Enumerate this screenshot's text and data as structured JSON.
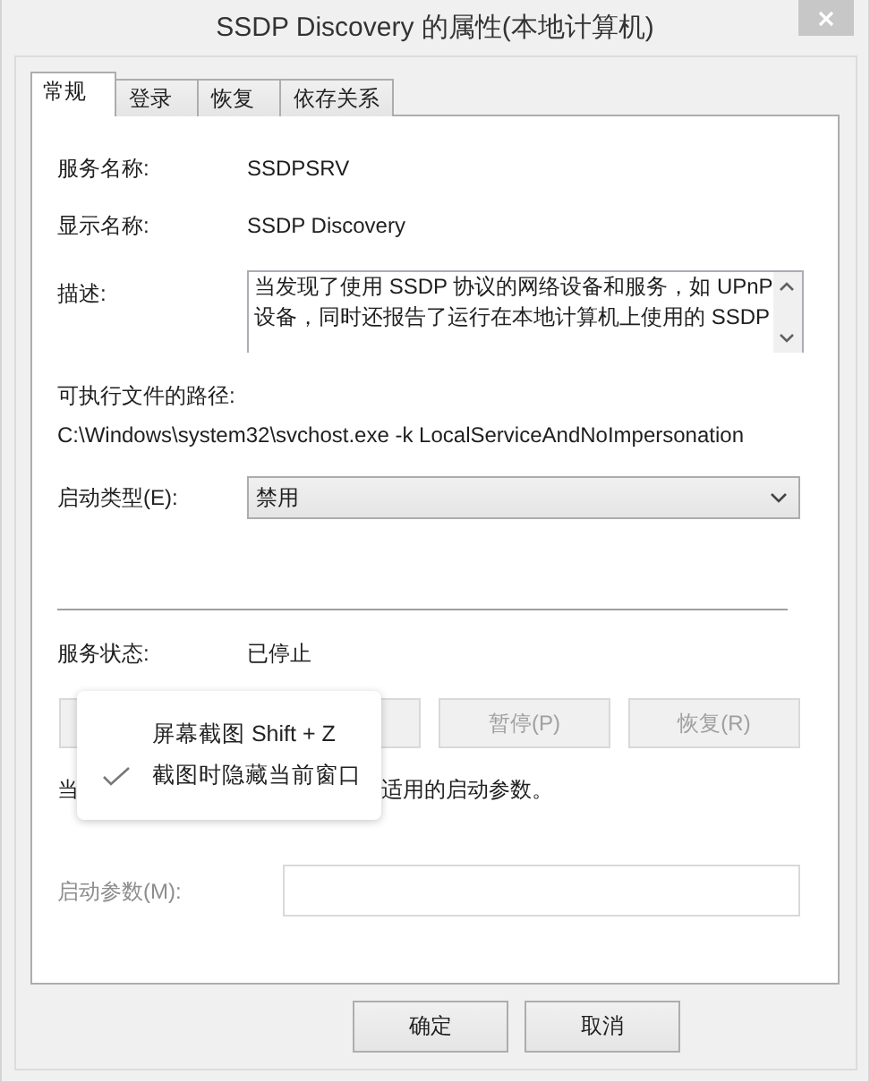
{
  "window": {
    "title": "SSDP Discovery 的属性(本地计算机)"
  },
  "tabs": [
    {
      "label": "常规",
      "selected": true
    },
    {
      "label": "登录",
      "selected": false
    },
    {
      "label": "恢复",
      "selected": false
    },
    {
      "label": "依存关系",
      "selected": false
    }
  ],
  "service_name": {
    "label": "服务名称:",
    "value": "SSDPSRV"
  },
  "display_name": {
    "label": "显示名称:",
    "value": "SSDP Discovery"
  },
  "description": {
    "label": "描述:",
    "lines": [
      "当发现了使用 SSDP 协议的网络设备和服务，如 UPnP",
      "设备，同时还报告了运行在本地计算机上使用的 SSDP"
    ]
  },
  "path": {
    "label": "可执行文件的路径:",
    "value": "C:\\Windows\\system32\\svchost.exe -k LocalServiceAndNoImpersonation"
  },
  "startup_type": {
    "label": "启动类型(E):",
    "value": "禁用"
  },
  "service_status": {
    "label": "服务状态:",
    "value": "已停止"
  },
  "service_buttons": [
    {
      "disabled": true
    },
    {
      "disabled": true
    },
    {
      "label": "暂停(P)",
      "disabled": true
    },
    {
      "label": "恢复(R)",
      "disabled": true
    }
  ],
  "note": {
    "before": "当",
    "after": "适用的启动参数。"
  },
  "start_params": {
    "label": "启动参数(M):",
    "disabled": true
  },
  "buttons": [
    {
      "label": "确定"
    },
    {
      "label": "取消"
    }
  ],
  "context_menu": [
    {
      "label": "屏幕截图 Shift + Z",
      "checked": false
    },
    {
      "label": "截图时隐藏当前窗口",
      "checked": true
    }
  ]
}
